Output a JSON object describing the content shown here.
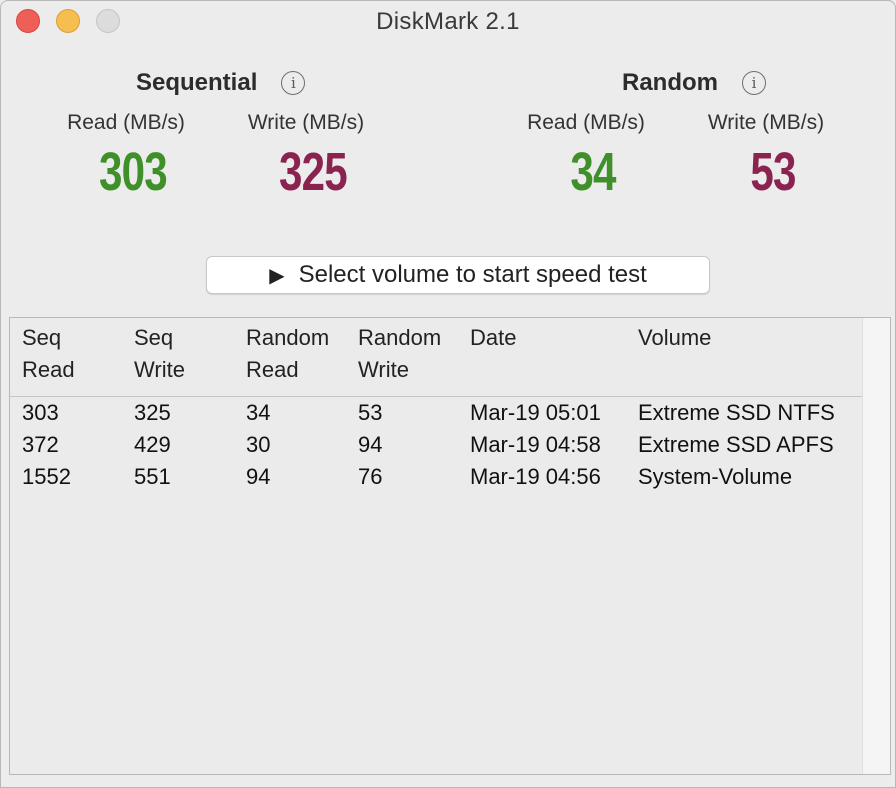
{
  "window": {
    "title": "DiskMark 2.1"
  },
  "colors": {
    "read": "#3f8f2a",
    "write": "#8b2350"
  },
  "sequential": {
    "label": "Sequential",
    "read_label": "Read (MB/s)",
    "write_label": "Write (MB/s)",
    "read_value": "303",
    "write_value": "325"
  },
  "random": {
    "label": "Random",
    "read_label": "Read (MB/s)",
    "write_label": "Write (MB/s)",
    "read_value": "34",
    "write_value": "53"
  },
  "start_button": {
    "icon": "play-icon",
    "label": "Select volume to start speed test"
  },
  "table": {
    "headers": [
      {
        "line1": "Seq",
        "line2": "Read"
      },
      {
        "line1": "Seq",
        "line2": "Write"
      },
      {
        "line1": "Random",
        "line2": "Read"
      },
      {
        "line1": "Random",
        "line2": "Write"
      },
      {
        "line1": "Date",
        "line2": ""
      },
      {
        "line1": "Volume",
        "line2": ""
      }
    ],
    "rows": [
      [
        "303",
        "325",
        "34",
        "53",
        "Mar-19 05:01",
        "Extreme SSD NTFS"
      ],
      [
        "372",
        "429",
        "30",
        "94",
        "Mar-19 04:58",
        "Extreme SSD APFS"
      ],
      [
        "1552",
        "551",
        "94",
        "76",
        "Mar-19 04:56",
        "System-Volume"
      ]
    ]
  }
}
